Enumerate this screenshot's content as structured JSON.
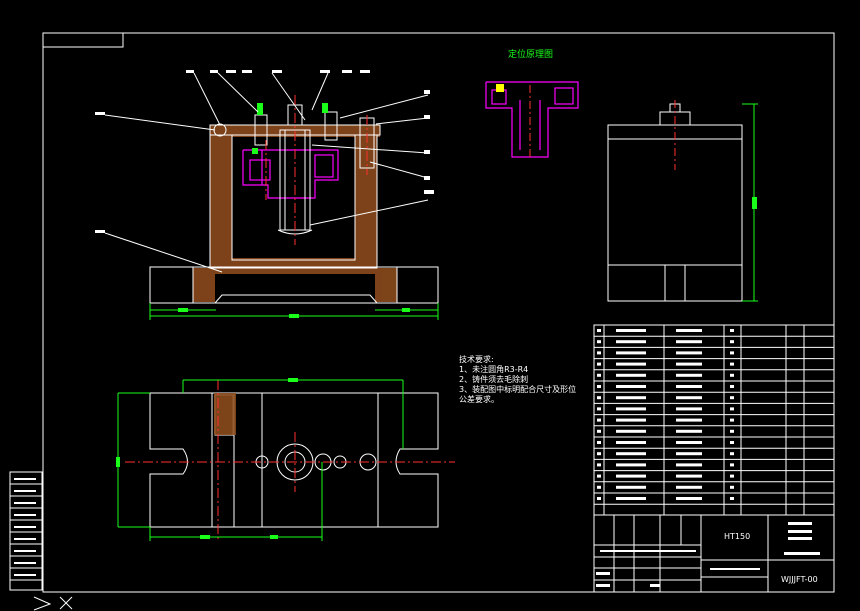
{
  "locating_diagram_title": "定位原理图",
  "technical_requirements": {
    "heading": "技术要求:",
    "lines": [
      "1、未注圆角R3-R4",
      "2、铸件须去毛除刺",
      "3、装配图中标明配合尺寸及形位",
      "公差要求。"
    ]
  },
  "title_block": {
    "material": "HT150",
    "drawing_number": "WJJJFT-00"
  },
  "colors": {
    "background": "#000000",
    "outline": "#ffffff",
    "section": "#ff3030",
    "dimension": "#19ff19",
    "part": "#ff00ff",
    "hatch": "#8b4a1c"
  }
}
